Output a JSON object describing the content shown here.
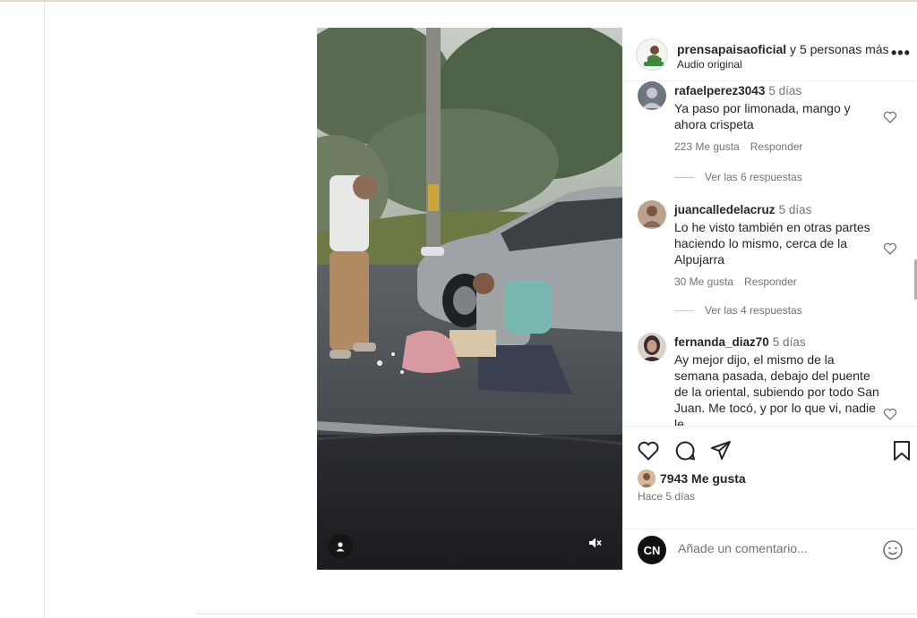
{
  "post": {
    "author": "prensapaisaoficial",
    "coauthors": " y 5 personas más",
    "audio": "Audio original",
    "more_label": "•••"
  },
  "comments": [
    {
      "user": "rafaelperez3043",
      "time": "5 días",
      "text": "Ya paso por limonada, mango y ahora crispeta",
      "likes": "223 Me gusta",
      "reply": "Responder",
      "view_replies": "Ver las 6 respuestas",
      "avatar_color": "#6e7480"
    },
    {
      "user": "juancalledelacruz",
      "time": "5 días",
      "text": "Lo he visto también en otras partes haciendo lo mismo, cerca de la Alpujarra",
      "likes": "30 Me gusta",
      "reply": "Responder",
      "view_replies": "Ver las 4 respuestas",
      "avatar_color": "#8a6a55"
    },
    {
      "user": "fernanda_diaz70",
      "time": "5 días",
      "text": "Ay mejor dijo, el mismo de la semana pasada, debajo del puente de la oriental, subiendo por todo San Juan. Me tocó, y por lo que vi, nadie le",
      "avatar_color": "#3a2c28"
    }
  ],
  "actions": {
    "icons": [
      "heart-icon",
      "comment-icon",
      "share-icon",
      "bookmark-icon"
    ],
    "likes": "7943 Me gusta",
    "time_ago": "Hace 5 días"
  },
  "composer": {
    "avatar_label": "CN",
    "placeholder": "Añade un comentario...",
    "emoji_icon": "smiley-icon"
  },
  "video": {
    "user_icon": "user-tag-icon",
    "mute_icon": "muted-speaker-icon"
  }
}
